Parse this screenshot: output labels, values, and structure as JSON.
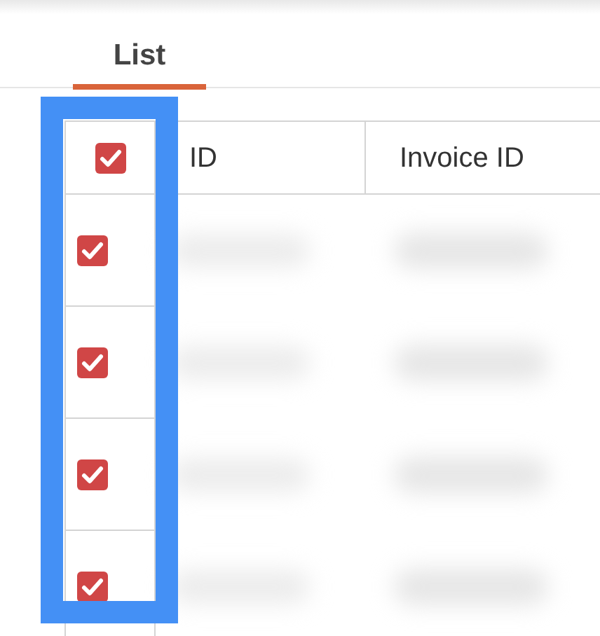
{
  "tabs": [
    {
      "label": "List",
      "selected": true
    }
  ],
  "table": {
    "select_all": {
      "checked": true
    },
    "columns": [
      "ID",
      "Invoice ID"
    ],
    "rows": [
      {
        "checked": true
      },
      {
        "checked": true
      },
      {
        "checked": true
      },
      {
        "checked": true
      }
    ]
  }
}
